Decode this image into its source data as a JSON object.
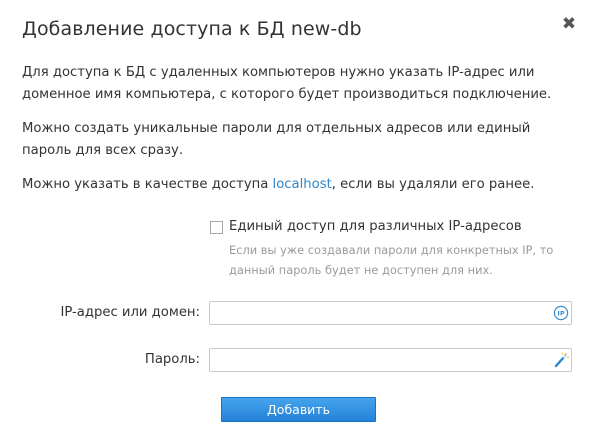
{
  "dialog": {
    "title": "Добавление доступа к БД new-db",
    "close_glyph": "✖"
  },
  "description": {
    "p1": "Для доступа к БД с удаленных компьютеров нужно указать IP-адрес или доменное имя компьютера, с которого будет производиться подключение.",
    "p2": "Можно создать уникальные пароли для отдельных адресов или единый пароль для всех сразу.",
    "p3_before": "Можно указать в качестве доступа ",
    "p3_link": "localhost",
    "p3_after": ", если вы удаляли его ранее."
  },
  "single_access": {
    "checked": false,
    "label": "Единый доступ для различных IP-адресов",
    "hint": "Если вы уже создавали пароли для конкретных IP, то данный пароль будет не доступен для них."
  },
  "form": {
    "ip_label": "IP-адрес или домен:",
    "ip_value": "",
    "ip_icon": "ip-detect-icon",
    "password_label": "Пароль:",
    "password_value": "",
    "password_icon": "magic-wand-icon",
    "submit_label": "Добавить"
  },
  "colors": {
    "accent": "#2f86c9",
    "button_top": "#45a4ec",
    "button_bottom": "#2582d9",
    "hint": "#9a9a9a"
  }
}
